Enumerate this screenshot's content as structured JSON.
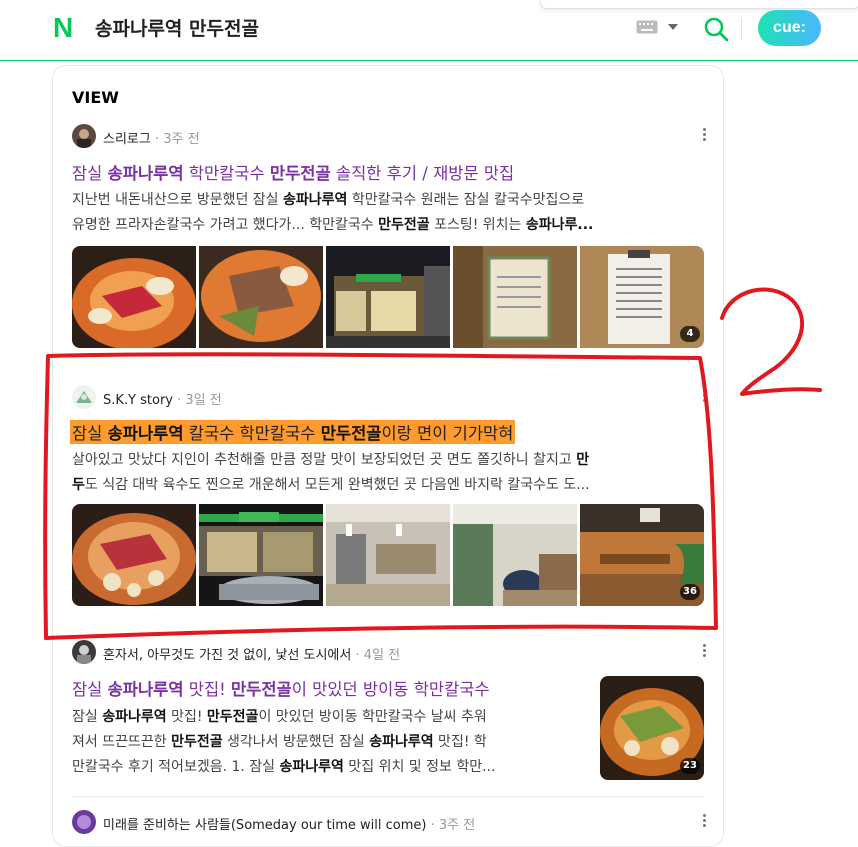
{
  "header": {
    "logo": "N",
    "query": "송파나루역 만두전골",
    "cue_label": "cue:",
    "icons": [
      "keyboard-icon",
      "dropdown-icon",
      "search-icon"
    ],
    "accent_color": "#03c75a"
  },
  "section": {
    "title": "VIEW"
  },
  "posts": [
    {
      "author": "스리로그",
      "time": "· 3주 전",
      "title_parts": [
        "잠실 ",
        "송파나루역",
        " 학만칼국수 ",
        "만두전골",
        " 솔직한 후기 / 재방문 맛집"
      ],
      "snippet_line1_parts": [
        "지난번 내돈내산으로 방문했던 잠실 ",
        "송파나루역",
        " 학만칼국수 원래는 잠실 칼국수맛집으로"
      ],
      "snippet_line2_parts": [
        "유명한 프라자손칼국수 가려고 했다가... 학만칼국수 ",
        "만두전골",
        " 포스팅! 위치는 ",
        "송파나루..."
      ],
      "image_count": "4"
    },
    {
      "author": "S.K.Y story",
      "time": "· 3일 전",
      "title_parts": [
        "잠실 ",
        "송파나루역",
        " 칼국수 학만칼국수 ",
        "만두전골",
        "이랑 면이 기가막혀"
      ],
      "snippet_line1_parts": [
        "살아있고 맛났다 지인이 추천해줄 만큼 정말 맛이 보장되었던 곳 면도 쫄깃하니 찰지고 ",
        "만"
      ],
      "snippet_line2_parts": [
        "두",
        "도 식감 대박 육수도 찐으로 개운해서 모든게 완벽했던 곳 다음엔 바지락 칼국수도 도..."
      ],
      "image_count": "36"
    },
    {
      "author": "혼자서, 아무것도 가진 것 없이, 낯선 도시에서",
      "time": "· 4일 전",
      "title_parts": [
        "잠실 ",
        "송파나루역",
        " 맛집! ",
        "만두전골",
        "이 맛있던 방이동 학만칼국수"
      ],
      "snippet_line1_parts": [
        "잠실 ",
        "송파나루역",
        " 맛집! ",
        "만두전골",
        "이 맛있던 방이동 학만칼국수 날씨 추워"
      ],
      "snippet_line2_parts": [
        "져서 뜨끈뜨끈한 ",
        "만두전골",
        " 생각나서 방문했던 잠실 ",
        "송파나루역",
        " 맛집! 학"
      ],
      "snippet_line3_parts": [
        "만칼국수 후기 적어보겠음. 1. 잠실 ",
        "송파나루역",
        " 맛집 위치 및 정보 학만..."
      ],
      "image_count": "23"
    },
    {
      "author": "미래를 준비하는 사람들(Someday our time will come)",
      "time": "· 3주 전"
    }
  ],
  "annotation": {
    "label": "2",
    "color": "#e0191e"
  },
  "highlight_color": "#ff9a2e",
  "title_color": "#7a2fa3"
}
